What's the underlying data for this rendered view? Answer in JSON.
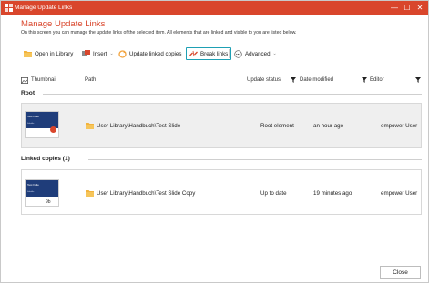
{
  "window": {
    "title": "Manage Update Links",
    "controls": {
      "minimize": "—",
      "maximize": "☐",
      "close": "✕"
    }
  },
  "header": {
    "title": "Manage Update Links",
    "subtitle": "On this screen you can manage the update links of the selected item. All elements that are linked and visible to you are listed below."
  },
  "toolbar": {
    "open_in_library": "Open in Library",
    "insert": "Insert",
    "update_linked_copies": "Update linked copies",
    "break_links": "Break links",
    "advanced": "Advanced"
  },
  "columns": {
    "thumbnail": "Thumbnail",
    "path": "Path",
    "update_status": "Update status",
    "date_modified": "Date modified",
    "editor": "Editor"
  },
  "sections": {
    "root": "Root",
    "linked_copies": "Linked copies (1)"
  },
  "rows": [
    {
      "path": "User Library\\Handbuch\\Test Slide",
      "update_status": "Root element",
      "date_modified": "an hour ago",
      "editor": "empower User",
      "thumb_title": "Test Folie",
      "thumb_sub": "Subtitle"
    },
    {
      "path": "User Library\\Handbuch\\Test Slide Copy",
      "update_status": "Up to date",
      "date_modified": "19 minutes ago",
      "editor": "empower User",
      "thumb_title": "Test Folie",
      "thumb_sub": "Subtitle"
    }
  ],
  "footer": {
    "close": "Close"
  },
  "colors": {
    "accent": "#d9462c",
    "highlight": "#1ea0b4"
  }
}
